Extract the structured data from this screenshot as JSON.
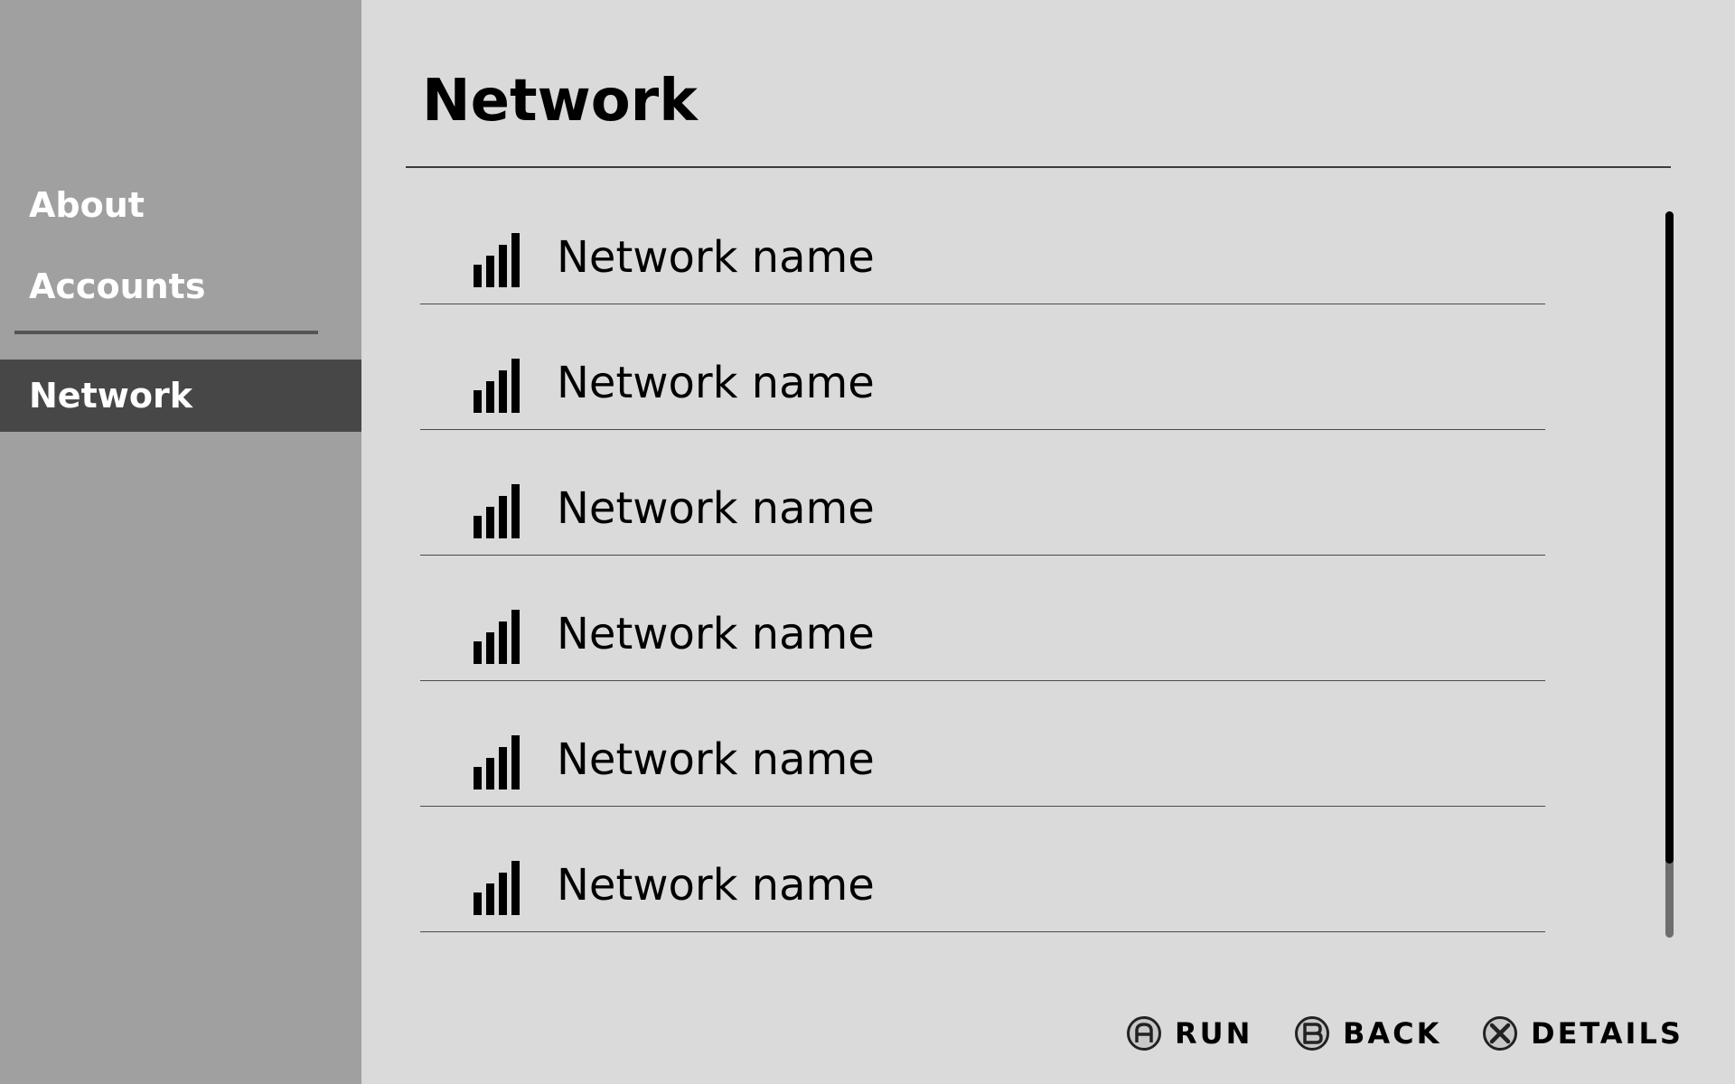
{
  "sidebar": {
    "items": [
      {
        "label": "About"
      },
      {
        "label": "Accounts"
      },
      {
        "label": "Network"
      }
    ]
  },
  "main": {
    "title": "Network",
    "networks": [
      {
        "name": "Network name",
        "icon": "signal-strength-icon"
      },
      {
        "name": "Network name",
        "icon": "signal-strength-icon"
      },
      {
        "name": "Network name",
        "icon": "signal-strength-icon"
      },
      {
        "name": "Network name",
        "icon": "signal-strength-icon"
      },
      {
        "name": "Network name",
        "icon": "signal-strength-icon"
      },
      {
        "name": "Network name",
        "icon": "signal-strength-icon"
      }
    ]
  },
  "footer": {
    "actions": [
      {
        "button": "A",
        "label": "RUN",
        "icon": "a-button-icon"
      },
      {
        "button": "B",
        "label": "BACK",
        "icon": "b-button-icon"
      },
      {
        "button": "X",
        "label": "DETAILS",
        "icon": "x-button-icon"
      }
    ]
  },
  "colors": {
    "sidebar_bg": "#a0a0a0",
    "sidebar_selected_bg": "#474747",
    "main_bg": "#dadada",
    "text": "#000000",
    "sidebar_text": "#ffffff"
  }
}
